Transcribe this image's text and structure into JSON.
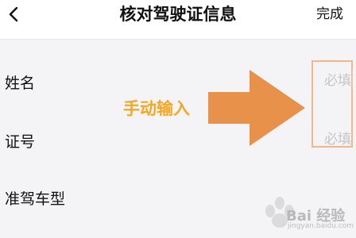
{
  "header": {
    "title": "核对驾驶证信息",
    "done_label": "完成",
    "back_icon": "chevron-left-icon"
  },
  "form": {
    "rows": [
      {
        "label": "姓名",
        "placeholder": "必填"
      },
      {
        "label": "证号",
        "placeholder": "必填"
      },
      {
        "label": "准驾车型"
      }
    ]
  },
  "annotation": {
    "text": "手动输入",
    "color": "#F5A623",
    "arrow_color": "#E8914A",
    "box_color": "#F2B788"
  },
  "watermark": {
    "text": "Bai 经验",
    "subtext": "jingyan.baidu.com"
  },
  "colors": {
    "background": "#F4F4F6",
    "header_bg": "#FFFFFF"
  }
}
